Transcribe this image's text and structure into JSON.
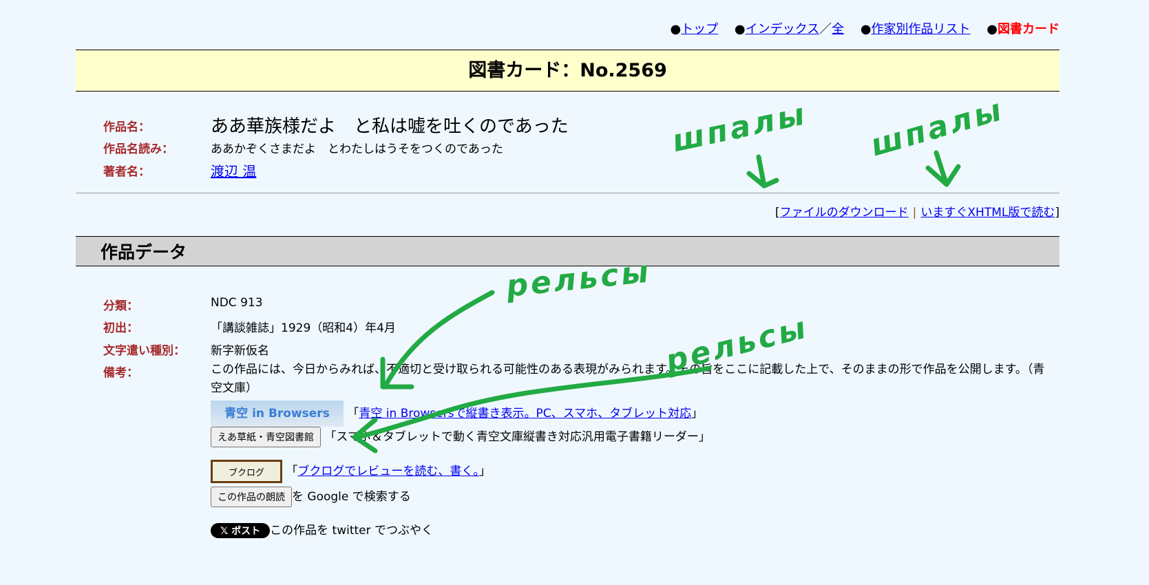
{
  "nav": {
    "items": [
      {
        "label": "トップ"
      },
      {
        "label": "インデックス"
      },
      {
        "label": "全"
      },
      {
        "label": "作家別作品リスト"
      },
      {
        "label": "図書カード"
      }
    ],
    "bullet": "●",
    "slash": "／"
  },
  "card": {
    "title": "図書カード：No.2569"
  },
  "work": {
    "title_label": "作品名：",
    "title": "ああ華族様だよ　と私は嘘を吐くのであった",
    "reading_label": "作品名読み：",
    "reading": "ああかぞくさまだよ　とわたしはうそをつくのであった",
    "author_label": "著者名：",
    "author": "渡辺 温"
  },
  "download": {
    "open": "[",
    "download_label": "ファイルのダウンロード",
    "sep": "|",
    "xhtml_label": "いますぐXHTML版で読む",
    "close": "]"
  },
  "section": {
    "title": "作品データ"
  },
  "data": {
    "ndc_label": "分類：",
    "ndc": "NDC 913",
    "first_label": "初出：",
    "first": "「講談雑誌」1929（昭和4）年4月",
    "kana_label": "文字遣い種別：",
    "kana": "新字新仮名",
    "note_label": "備考：",
    "note": "この作品には、今日からみれば、不適切と受け取られる可能性のある表現がみられます。その旨をここに記載した上で、そのままの形で作品を公開します。（青空文庫）"
  },
  "links": {
    "aozora_badge": "青空 in Browsers",
    "aozora_link": "青空 in Browsersで縦書き表示。PC、スマホ、タブレット対応",
    "ea_button": "えあ草紙・青空図書館",
    "ea_text": "スマホ＆タブレットで動く青空文庫縦書き対応汎用電子書籍リーダー",
    "booklog_badge": "ブクログ",
    "booklog_link": "ブクログでレビューを読む、書く。",
    "google_button": "この作品の朗読",
    "google_text": "を Google で検索する",
    "x_button": "𝕏 ポスト",
    "x_text": "この作品を twitter でつぶやく",
    "open_q": "「",
    "close_q": "」"
  },
  "annotations": {
    "sleepers": "шпалы",
    "rails": "рельсы",
    "color": "#22aa44"
  }
}
